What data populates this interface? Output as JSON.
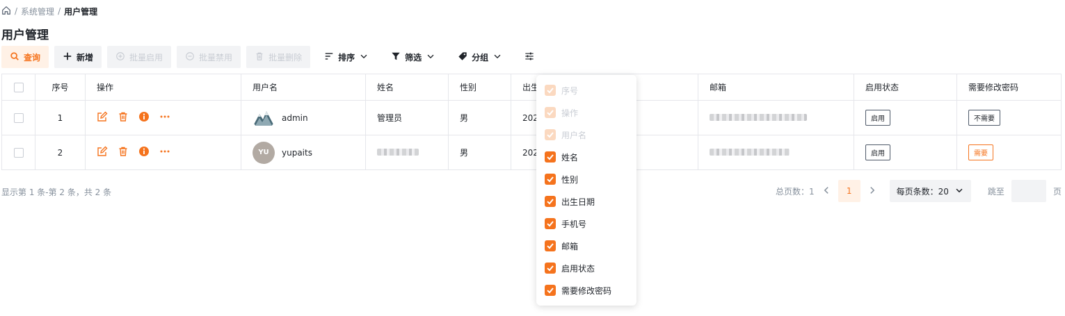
{
  "breadcrumb": {
    "items": [
      "系统管理",
      "用户管理"
    ],
    "separator": "/"
  },
  "page_title": "用户管理",
  "toolbar": {
    "query": "查询",
    "add": "新增",
    "batch_enable": "批量启用",
    "batch_disable": "批量禁用",
    "batch_delete": "批量删除",
    "sort": "排序",
    "filter": "筛选",
    "group": "分组"
  },
  "table": {
    "headers": [
      "序号",
      "操作",
      "用户名",
      "姓名",
      "性别",
      "出生",
      "邮箱",
      "启用状态",
      "需要修改密码"
    ],
    "rows": [
      {
        "index": "1",
        "username": "admin",
        "name": "管理员",
        "gender": "男",
        "birth": "2020",
        "status": "启用",
        "pwd_change": "不需要"
      },
      {
        "index": "2",
        "username": "yupaits",
        "avatar_text": "YU",
        "gender": "男",
        "birth": "202",
        "status": "启用",
        "pwd_change": "需要"
      }
    ]
  },
  "footer": {
    "summary": "显示第 1 条-第 2 条，共 2 条",
    "total_pages": "总页数：1",
    "current_page": "1",
    "page_size": "每页条数：20",
    "jump_prefix": "跳至",
    "jump_suffix": "页"
  },
  "column_menu": {
    "items": [
      {
        "label": "序号",
        "checked": true,
        "disabled": true
      },
      {
        "label": "操作",
        "checked": true,
        "disabled": true
      },
      {
        "label": "用户名",
        "checked": true,
        "disabled": true
      },
      {
        "label": "姓名",
        "checked": true,
        "disabled": false
      },
      {
        "label": "性别",
        "checked": true,
        "disabled": false
      },
      {
        "label": "出生日期",
        "checked": true,
        "disabled": false
      },
      {
        "label": "手机号",
        "checked": true,
        "disabled": false
      },
      {
        "label": "邮箱",
        "checked": true,
        "disabled": false
      },
      {
        "label": "启用状态",
        "checked": true,
        "disabled": false
      },
      {
        "label": "需要修改密码",
        "checked": true,
        "disabled": false
      }
    ]
  },
  "colors": {
    "accent": "#f5731d",
    "accent_light": "#fff1e6",
    "border": "#e5e6eb",
    "muted": "#86909c"
  }
}
